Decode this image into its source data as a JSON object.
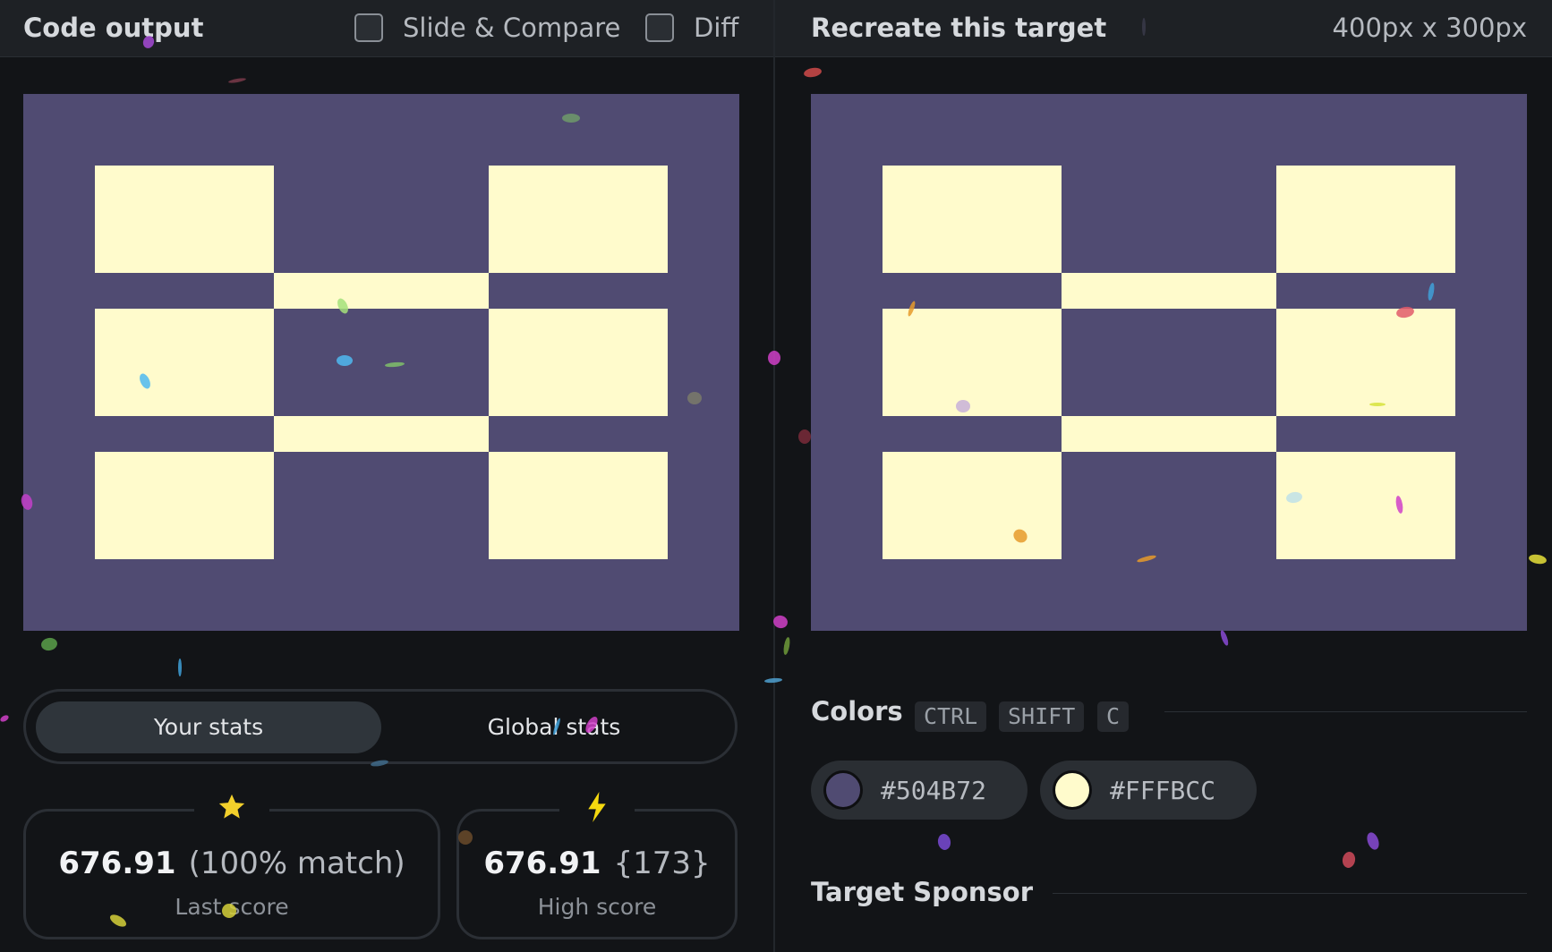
{
  "left_panel": {
    "title": "Code output",
    "slide_compare_label": "Slide & Compare",
    "diff_label": "Diff"
  },
  "right_panel": {
    "title": "Recreate this target",
    "dimensions": "400px x 300px"
  },
  "canvas_colors": {
    "background": "#504B72",
    "foreground": "#FFFBCC"
  },
  "stats": {
    "tabs": {
      "your_stats": "Your stats",
      "global_stats": "Global stats"
    },
    "last": {
      "value": "676.91",
      "detail": "(100% match)",
      "caption": "Last score",
      "icon": "star-icon"
    },
    "high": {
      "value": "676.91",
      "detail": "{173}",
      "caption": "High score",
      "icon": "lightning-icon"
    }
  },
  "colors_section": {
    "title": "Colors",
    "shortcut": [
      "CTRL",
      "SHIFT",
      "C"
    ],
    "swatches": [
      {
        "hex": "#504B72"
      },
      {
        "hex": "#FFFBCC"
      }
    ]
  },
  "sponsor_section": {
    "title": "Target Sponsor"
  },
  "accent": {
    "star": "#f2cf2b",
    "lightning": "#f5d90f"
  }
}
